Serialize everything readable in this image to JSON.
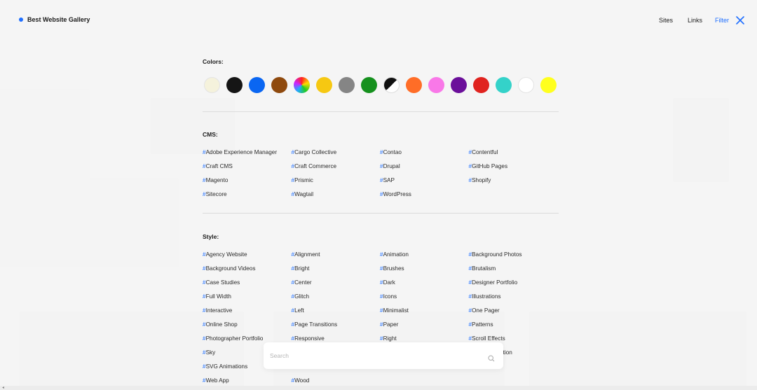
{
  "brand": {
    "name": "Best Website Gallery",
    "accent": "#1f6fff"
  },
  "nav": {
    "sites": "Sites",
    "links": "Links",
    "filter": "Filter"
  },
  "colors": {
    "title": "Colors:",
    "swatches": [
      {
        "name": "beige",
        "value": "#f5f2dc"
      },
      {
        "name": "black",
        "value": "#151515"
      },
      {
        "name": "blue",
        "value": "#0a66f2"
      },
      {
        "name": "brown",
        "value": "#8f4a0e"
      },
      {
        "name": "multicolor",
        "value": "multicolor"
      },
      {
        "name": "orange-yellow",
        "value": "#f6c812"
      },
      {
        "name": "grey",
        "value": "#858585"
      },
      {
        "name": "green",
        "value": "#16911e"
      },
      {
        "name": "black-white",
        "value": "black-white"
      },
      {
        "name": "orange",
        "value": "#ff6d27"
      },
      {
        "name": "pink",
        "value": "#f978e8"
      },
      {
        "name": "purple",
        "value": "#6b0f9a"
      },
      {
        "name": "red",
        "value": "#e0231f"
      },
      {
        "name": "turquoise",
        "value": "#34d2c9"
      },
      {
        "name": "white",
        "value": "#ffffff"
      },
      {
        "name": "yellow",
        "value": "#ffff1e"
      }
    ]
  },
  "cms": {
    "title": "CMS:",
    "tags": [
      "Adobe Experience Manager",
      "Cargo Collective",
      "Contao",
      "Contentful",
      "Craft CMS",
      "Craft Commerce",
      "Drupal",
      "GitHub Pages",
      "Magento",
      "Prismic",
      "SAP",
      "Shopify",
      "Sitecore",
      "Wagtail",
      "WordPress"
    ]
  },
  "style": {
    "title": "Style:",
    "tags": [
      "Agency Website",
      "Alignment",
      "Animation",
      "Background Photos",
      "Background Videos",
      "Bright",
      "Brushes",
      "Brutalism",
      "Case Studies",
      "Center",
      "Dark",
      "Designer Portfolio",
      "Full Width",
      "Glitch",
      "Icons",
      "Illustrations",
      "Interactive",
      "Left",
      "Minimalist",
      "One Pager",
      "Online Shop",
      "Page Transitions",
      "Paper",
      "Patterns",
      "Photographer Portfolio",
      "Responsive",
      "Right",
      "Scroll Effects",
      "Sky",
      "",
      "",
      "gation",
      "SVG Animations",
      "",
      "",
      "",
      "Web App",
      "Wood",
      "",
      ""
    ]
  },
  "hash": "#",
  "search": {
    "placeholder": "Search",
    "value": ""
  }
}
